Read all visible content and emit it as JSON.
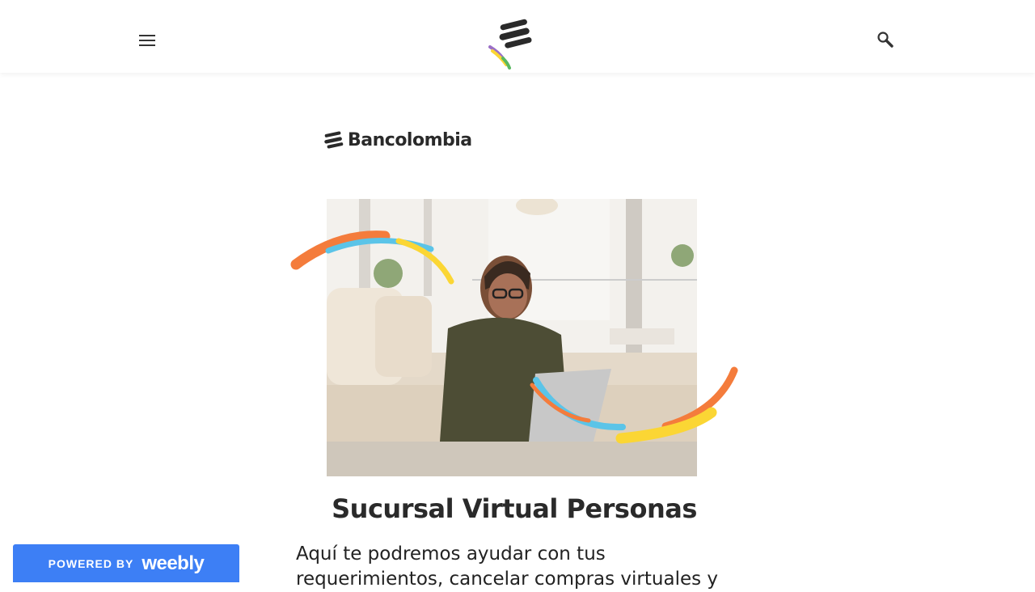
{
  "header": {
    "menu_icon": "hamburger-menu-icon",
    "logo_icon": "bancolombia-logo-mark",
    "search_icon": "search-icon"
  },
  "content": {
    "brand_name": "Bancolombia",
    "image_alt": "Mujer sonriente usando un portátil en la sala",
    "title": "Sucursal Virtual Personas",
    "body": "Aquí te podremos ayudar con tus requerimientos, cancelar compras virtuales y"
  },
  "footer_badge": {
    "powered_label": "POWERED BY",
    "brand": "weebly"
  },
  "colors": {
    "orange": "#f47c3c",
    "blue": "#5bc4e8",
    "yellow": "#fbd634",
    "purple": "#9b6fc6",
    "green": "#59b85f",
    "weebly_blue": "#3d7ff5",
    "dark": "#2a2a2a"
  }
}
